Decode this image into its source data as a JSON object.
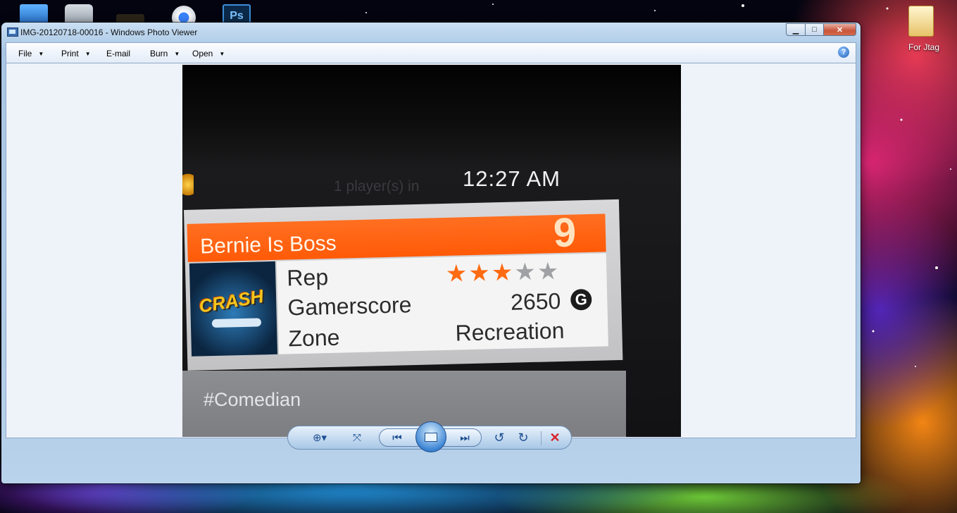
{
  "desktop": {
    "folder_label": "For Jtag"
  },
  "window": {
    "title": "IMG-20120718-00016 - Windows Photo Viewer",
    "controls": {
      "minimize": "▁",
      "maximize": "□",
      "close": "✕"
    }
  },
  "menu": {
    "items": [
      {
        "label": "File",
        "has_dropdown": true
      },
      {
        "label": "Print",
        "has_dropdown": true
      },
      {
        "label": "E-mail",
        "has_dropdown": false
      },
      {
        "label": "Burn",
        "has_dropdown": true
      },
      {
        "label": "Open",
        "has_dropdown": true
      }
    ],
    "help_glyph": "?"
  },
  "photo": {
    "ghost_text": "1 player(s) in",
    "clock": "12:27  AM",
    "gamertag": "Bernie Is Boss",
    "level": "9",
    "rep_label": "Rep",
    "rep_stars": 3,
    "rep_max": 5,
    "gamerscore_label": "Gamerscore",
    "gamerscore_value": "2650",
    "gamerscore_glyph": "G",
    "zone_label": "Zone",
    "zone_value": "Recreation",
    "motto": "#Comedian",
    "gamerpic_text": "CRASH"
  },
  "toolbar": {
    "zoom_glyph": "⊕▾",
    "fit_glyph": "⤧",
    "prev_glyph": "⏮",
    "next_glyph": "⏭",
    "rotate_ccw_glyph": "↺",
    "rotate_cw_glyph": "↻",
    "delete_glyph": "✕"
  },
  "colors": {
    "accent_orange": "#ff5a07",
    "delete_red": "#d8232a",
    "toolbar_blue": "#1d4f92"
  }
}
